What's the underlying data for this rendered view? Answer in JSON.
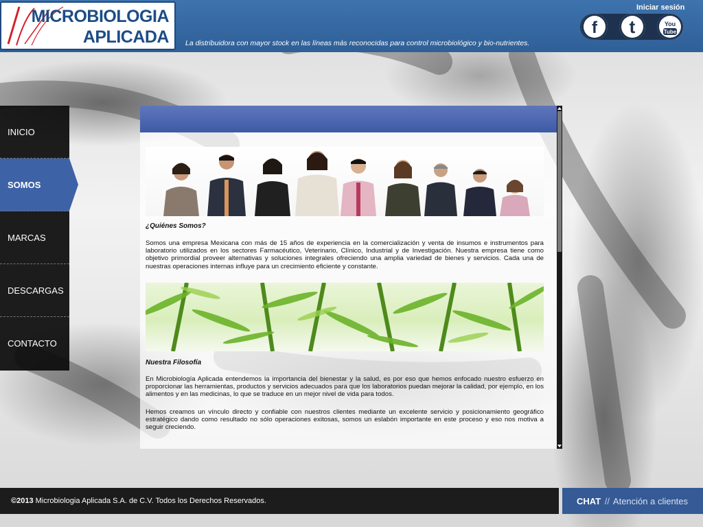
{
  "header": {
    "logo_line1": "MICROBIOLOGIA",
    "logo_line2": "APLICADA",
    "tagline": "La distribuidora con mayor stock en las líneas más reconocidas para control microbiológico y bio-nutrientes.",
    "login": "Iniciar sesión",
    "social": [
      {
        "name": "facebook",
        "label": "f"
      },
      {
        "name": "twitter",
        "label": "t"
      },
      {
        "name": "youtube",
        "label": "You Tube"
      }
    ]
  },
  "menu": {
    "items": [
      {
        "label": "INICIO",
        "active": false
      },
      {
        "label": "SOMOS",
        "active": true
      },
      {
        "label": "MARCAS",
        "active": false
      },
      {
        "label": "DESCARGAS",
        "active": false
      },
      {
        "label": "CONTACTO",
        "active": false
      }
    ]
  },
  "content": {
    "section1_title": "¿Quiénes Somos?",
    "section1_text": "Somos una empresa Mexicana con más de 15 años de experiencia en la comercialización y venta de insumos e instrumentos para laboratorio utilizados en los sectores Farmacéutico, Veterinario, Clínico, Industrial y de Investigación. Nuestra empresa tiene como objetivo primordial proveer alternativas y soluciones integrales ofreciendo una amplia variedad de bienes y servicios. Cada una de nuestras operaciones internas influye para un crecimiento eficiente y constante.",
    "section2_title": "Nuestra Filosofía",
    "section2_text1": "En Microbiología Aplicada entendemos la importancia del bienestar y la salud, es por eso que hemos enfocado nuestro esfuerzo en proporcionar las herramientas, productos y servicios adecuados para que los laboratorios puedan mejorar la calidad, por ejemplo, en los alimentos y en las medicinas, lo que se traduce en un mejor nivel de vida para todos.",
    "section2_text2": "Hemos creamos un vínculo directo y confiable con nuestros clientes mediante un excelente servicio y posicionamiento geográfico estratégico dando como resultado no sólo operaciones exitosas, somos un eslabón importante en este proceso y eso nos motiva a seguir creciendo."
  },
  "footer": {
    "copyright_year": "©2013",
    "copyright_text": "Microbiologia Aplicada S.A. de C.V. Todos los Derechos Reservados.",
    "chat_label": "CHAT",
    "chat_sep": "//",
    "chat_sub": "Atención a clientes"
  },
  "colors": {
    "header_blue": "#3e73ad",
    "menu_active": "#3d62a6",
    "panel_header": "#4a64ae",
    "footer_dark": "#1c1c1c",
    "chat_blue": "#355a95"
  }
}
